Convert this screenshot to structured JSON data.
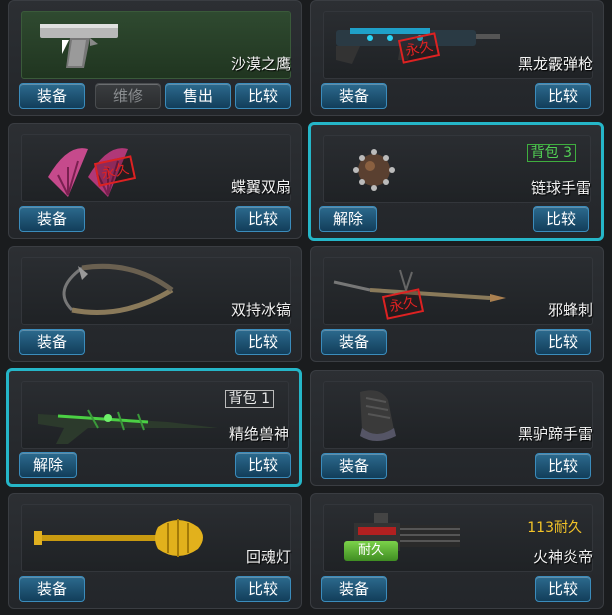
{
  "items": [
    {
      "name": "沙漠之鹰",
      "buttons": [
        "装备",
        "维修",
        "售出",
        "比较"
      ],
      "icon": "desert-eagle-pistol"
    },
    {
      "name": "黑龙霰弹枪",
      "buttons": [
        "装备",
        "比较"
      ],
      "stamp": "永久",
      "icon": "shotgun"
    },
    {
      "name": "蝶翼双扇",
      "buttons": [
        "装备",
        "比较"
      ],
      "stamp": "永久",
      "icon": "dual-fans"
    },
    {
      "name": "链球手雷",
      "buttons": [
        "解除",
        "比较"
      ],
      "tag": "背包 3",
      "selected": true,
      "icon": "spiked-ball-grenade"
    },
    {
      "name": "双持冰镐",
      "buttons": [
        "装备",
        "比较"
      ],
      "icon": "ice-axes"
    },
    {
      "name": "邪蜂刺",
      "buttons": [
        "装备",
        "比较"
      ],
      "stamp": "永久",
      "icon": "spear"
    },
    {
      "name": "精绝兽神",
      "buttons": [
        "解除",
        "比较"
      ],
      "tag": "背包 1",
      "selected": true,
      "icon": "rifle"
    },
    {
      "name": "黑驴蹄手雷",
      "buttons": [
        "装备",
        "比较"
      ],
      "icon": "hoof-grenade"
    },
    {
      "name": "回魂灯",
      "buttons": [
        "装备",
        "比较"
      ],
      "icon": "golden-lamp-mace"
    },
    {
      "name": "火神炎帝",
      "buttons": [
        "装备",
        "比较"
      ],
      "durability": "113耐久",
      "badge": "耐久",
      "icon": "gatling-gun"
    }
  ],
  "colors": {
    "accent": "#25b6c8",
    "button": "#1d5577",
    "durability": "#f3c428",
    "stamp": "#e02222",
    "tag_green": "#52d054"
  }
}
